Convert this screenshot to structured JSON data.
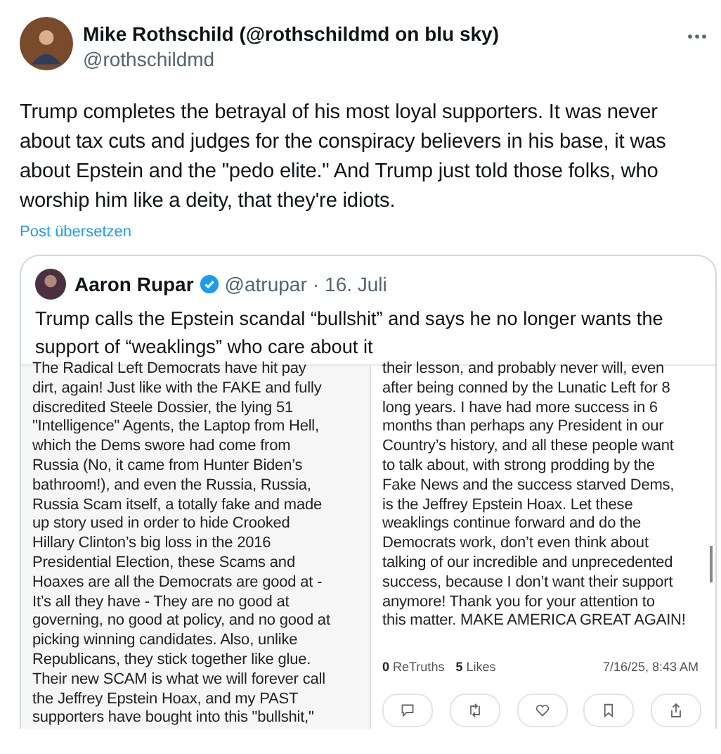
{
  "post": {
    "author_name": "Mike Rothschild (@rothschildmd on blu sky)",
    "handle": "@rothschildmd",
    "text_lines": [
      "Trump completes the betrayal of his most loyal supporters. It was never",
      "about tax cuts and judges for the conspiracy believers in his base, it was",
      "about Epstein and the \"pedo elite.\" And Trump just told those folks, who",
      "worship him like a deity, that they're idiots."
    ],
    "translate_link": "Post übersetzen"
  },
  "quote": {
    "author_name": "Aaron Rupar",
    "handle": "@atrupar",
    "separator": "·",
    "date": "16. Juli",
    "text_lines": [
      "Trump calls the Epstein scandal “bullshit” and says he no longer wants the",
      "support of “weaklings” who care about it"
    ],
    "media": {
      "left_lines": [
        "The Radical Left Democrats have hit pay",
        "dirt, again! Just like with the FAKE and fully",
        "discredited Steele Dossier, the lying 51",
        "\"Intelligence\" Agents, the Laptop from Hell,",
        "which the Dems swore had come from",
        "Russia (No, it came from Hunter Biden’s",
        "bathroom!), and even the Russia, Russia,",
        "Russia Scam itself, a totally fake and made",
        "up story used in order to hide Crooked",
        "Hillary Clinton’s big loss in the 2016",
        "Presidential Election, these Scams and",
        "Hoaxes are all the Democrats are good at -",
        "It’s all they have - They are no good at",
        "governing, no good at policy, and no good at",
        "picking winning candidates. Also, unlike",
        "Republicans, they stick together like glue.",
        "Their new SCAM is what we will forever call",
        "the Jeffrey Epstein Hoax, and my PAST",
        "supporters have bought into this \"bullshit,\""
      ],
      "right_lines": [
        "their lesson, and probably never will, even",
        "after being conned by the Lunatic Left for 8",
        "long years. I have had more success in 6",
        "months than perhaps any President in our",
        "Country’s history, and all these people want",
        "to talk about, with strong prodding by the",
        "Fake News and the success starved Dems,",
        "is the Jeffrey Epstein Hoax. Let these",
        "weaklings continue forward and do the",
        "Democrats work, don’t even think about",
        "talking of our incredible and unprecedented",
        "success, because I don’t want their support",
        "anymore! Thank you for your attention to",
        "this matter. MAKE AMERICA GREAT AGAIN!"
      ],
      "retruths_count": "0",
      "retruths_label": "ReTruths",
      "likes_count": "5",
      "likes_label": "Likes",
      "timestamp": "7/16/25, 8:43 AM"
    }
  }
}
